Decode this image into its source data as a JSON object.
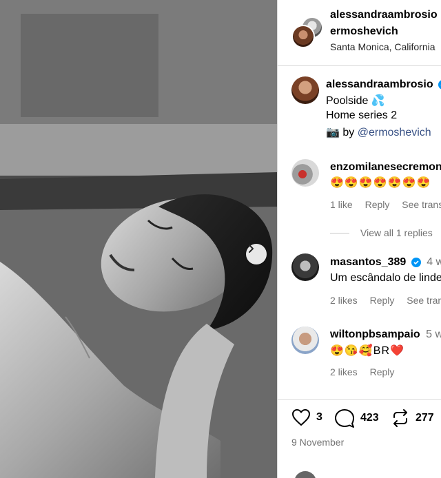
{
  "post": {
    "author": "alessandraambrosio",
    "collaborator": "ermoshevich",
    "location": "Santa Monica, California",
    "caption_line1": "Poolside",
    "caption_line1_emoji": "💦",
    "caption_line2": "Home series 2",
    "credit_icon": "📷",
    "credit_by": "by",
    "credit_mention": "@ermoshevich"
  },
  "comments": [
    {
      "user": "enzomilanesecremona",
      "text": "😍😍😍😍😍😍😍",
      "likes": "1 like",
      "reply": "Reply",
      "translate": "See translation"
    },
    {
      "user": "masantos_389",
      "time": "4 w",
      "text": "Um escândalo de lindeza",
      "likes": "2 likes",
      "reply": "Reply",
      "translate": "See translation"
    },
    {
      "user": "wiltonpbsampaio",
      "time": "5 w",
      "text": "😍😘🥰BR❤️",
      "likes": "2 likes",
      "reply": "Reply"
    }
  ],
  "view_all": "View all 1 replies",
  "stats": {
    "likes": "3",
    "comments": "423",
    "reposts": "277",
    "date": "9 November"
  },
  "colors": {
    "verified": "#0095f6",
    "link": "#385185",
    "muted": "#737373"
  }
}
